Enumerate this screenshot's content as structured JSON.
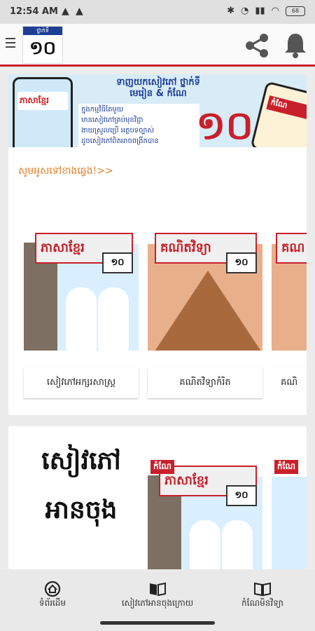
{
  "status": {
    "time": "12:54 AM",
    "warnings": [
      "▲",
      "▲"
    ],
    "battery": "68"
  },
  "appbar": {
    "logo_top": "ថ្នាក់ទី",
    "logo_num": "១០"
  },
  "banner": {
    "title1": "ទាញយកសៀវភៅ ថ្នាក់ទី",
    "title2": "មេរៀន & កំណែ",
    "lines": [
      "ក្នុងកម្មវិធីតែមួយ",
      "មានសៀវភៅគ្រប់មុខវិជ្ជា",
      "ងាយស្រួលប្រើ អត្ថបទច្បាស់",
      "ដូចសៀវភៅពិតអាចពង្រីកបាន"
    ],
    "num": "១០",
    "phone_text": "ភាសាខ្មែរ",
    "phone2_text": "កំណែ"
  },
  "promo": "សូមអូសទៅខាងឆ្វេង!>>",
  "section1": {
    "books": [
      {
        "title": "ភាសាខ្មែរ",
        "grade": "១០",
        "caption": "សៀវភៅអក្សរសាស្ត្រ"
      },
      {
        "title": "គណិតវិទ្យា",
        "grade": "១០",
        "caption": "គណិតវិទ្យាកំរិត"
      },
      {
        "title": "គណ",
        "grade": "",
        "caption": "គណិ"
      }
    ]
  },
  "section2": {
    "reading": {
      "line1": "សៀវភៅ",
      "line2": "អានចុង"
    },
    "books": [
      {
        "tag": "កំណែ",
        "title": "ភាសាខ្មែរ",
        "grade": "១០"
      },
      {
        "tag": "កំណែ",
        "title": "",
        "grade": ""
      }
    ]
  },
  "nav": {
    "home": "ទំព័រដើម",
    "reading": "សៀវភៅអានចុងក្រោយ",
    "answers": "កំណែមិនវិទ្យា"
  }
}
